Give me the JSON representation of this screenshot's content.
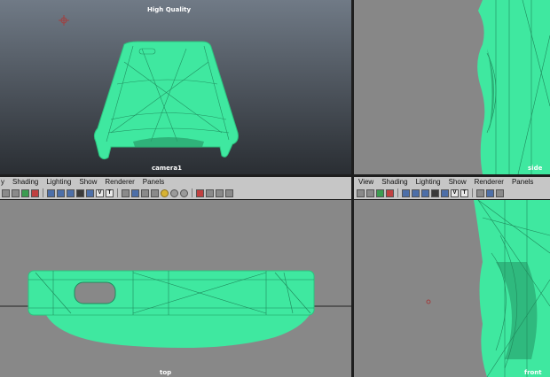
{
  "viewports": {
    "persp": {
      "label_top": "High Quality",
      "label_bottom": "camera1"
    },
    "side": {
      "label": "side"
    },
    "top": {
      "label": "top"
    },
    "front": {
      "label": "front"
    }
  },
  "menubar_left": {
    "items": [
      "y",
      "Shading",
      "Lighting",
      "Show",
      "Renderer",
      "Panels"
    ]
  },
  "menubar_right": {
    "items": [
      "View",
      "Shading",
      "Lighting",
      "Show",
      "Renderer",
      "Panels"
    ]
  },
  "icon_text": {
    "t_label": "T",
    "v_label": "V"
  },
  "colors": {
    "wire": "#3fe8a0",
    "persp_bg_top": "#707a86",
    "persp_bg_bottom": "#2a2e33",
    "ortho_bg": "#888888",
    "menu_bg": "#c6c6c6",
    "axis_line": "#222222"
  }
}
